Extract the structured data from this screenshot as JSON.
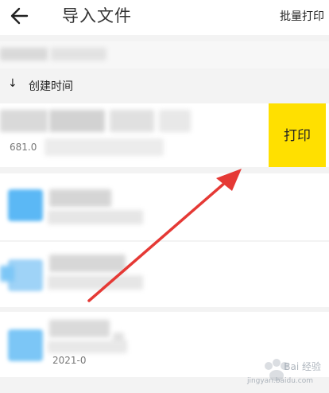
{
  "header": {
    "title": "导入文件",
    "batch_print": "批量打印",
    "back_icon": "arrow-left-icon"
  },
  "sort": {
    "arrow": "↓",
    "label": "创建时间"
  },
  "files": [
    {
      "meta": "681.0",
      "action": "打印"
    },
    {
      "meta": ""
    },
    {
      "meta": ""
    },
    {
      "meta": "2021-0"
    }
  ],
  "watermark": {
    "text": "Bai 经验",
    "sub": "jingyan.baidu.com"
  },
  "colors": {
    "print_button": "#ffe000",
    "annotation_arrow": "#e53935",
    "folder_icon": "#5bb8f5"
  }
}
